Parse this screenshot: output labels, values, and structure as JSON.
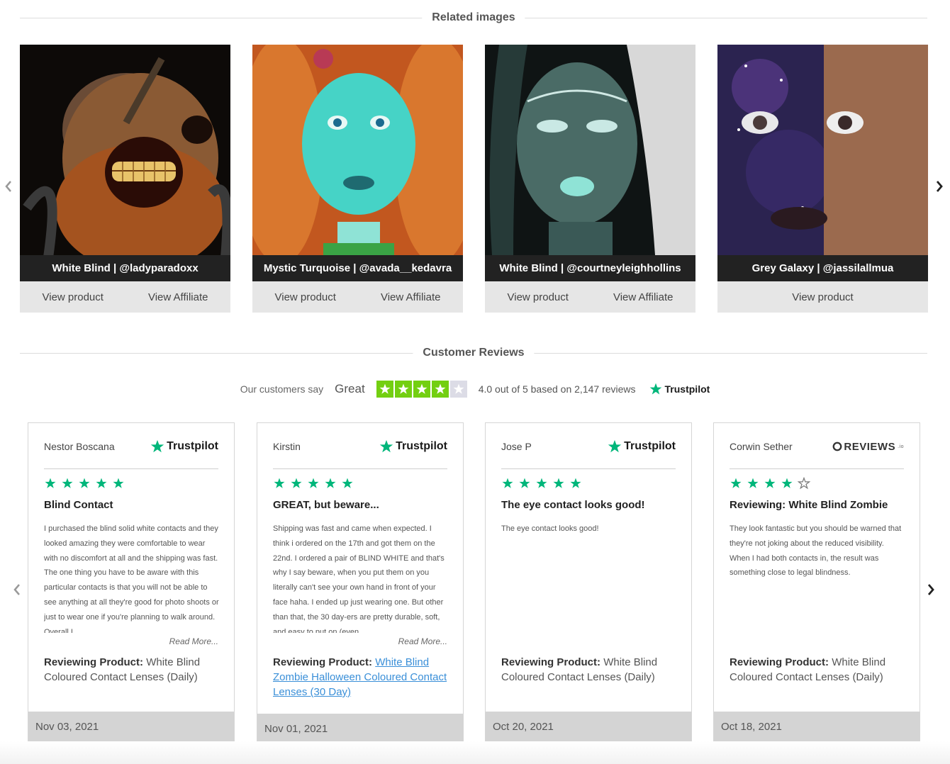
{
  "related": {
    "heading": "Related images",
    "cards": [
      {
        "caption": "White Blind | @ladyparadoxx",
        "view_product": "View product",
        "view_affiliate": "View Affiliate"
      },
      {
        "caption": "Mystic Turquoise | @avada__kedavra",
        "view_product": "View product",
        "view_affiliate": "View Affiliate"
      },
      {
        "caption": "White Blind | @courtneyleighhollins",
        "view_product": "View product",
        "view_affiliate": "View Affiliate"
      },
      {
        "caption": "Grey Galaxy | @jassilallmua",
        "view_product": "View product"
      }
    ]
  },
  "reviews": {
    "heading": "Customer Reviews",
    "summary": {
      "our_customers_say": "Our customers say",
      "rating_word": "Great",
      "stars": 4,
      "stars_max": 5,
      "based_text": "4.0 out of 5 based on 2,147 reviews",
      "brand": "Trustpilot"
    },
    "cards": [
      {
        "name": "Nestor Boscana",
        "source": "Trustpilot",
        "stars": 5,
        "title": "Blind Contact",
        "body": "I purchased the blind solid white contacts and they looked amazing they were comfortable to wear with no discomfort at all and the shipping was fast. The one thing you have to be aware with this particular contacts is that you will not be able to see anything at all they're good for photo shoots or just to wear one if you're planning to walk around. Overall I",
        "read_more": "Read More...",
        "product_label": "Reviewing Product:",
        "product": "White Blind Coloured Contact Lenses (Daily)",
        "date": "Nov 03, 2021"
      },
      {
        "name": "Kirstin",
        "source": "Trustpilot",
        "stars": 5,
        "title": "GREAT, but beware...",
        "body": "Shipping was fast and came when expected. I think i ordered on the 17th and got them on the 22nd. I ordered a pair of BLIND WHITE and that's why I say beware, when you put them on you literally can't see your own hand in front of your face haha. I ended up just wearing one. But other than that, the 30 day-ers are pretty durable, soft, and easy to put on (even",
        "read_more": "Read More...",
        "product_label": "Reviewing Product:",
        "product": "White Blind Zombie Halloween Coloured Contact Lenses (30 Day)",
        "date": "Nov 01, 2021"
      },
      {
        "name": "Jose P",
        "source": "Trustpilot",
        "stars": 5,
        "title": "The eye contact looks good!",
        "body": "The eye contact looks good!",
        "product_label": "Reviewing Product:",
        "product": "White Blind Coloured Contact Lenses (Daily)",
        "date": "Oct 20, 2021"
      },
      {
        "name": "Corwin Sether",
        "source": "REVIEWS",
        "source_suffix": ".io",
        "stars": 4,
        "title": "Reviewing: White Blind Zombie",
        "body": "They look fantastic but you should be warned that they're not joking about the reduced visibility. When I had both contacts in, the result was something close to legal blindness.",
        "product_label": "Reviewing Product:",
        "product": "White Blind Coloured Contact Lenses (Daily)",
        "date": "Oct 18, 2021"
      }
    ]
  },
  "colors": {
    "trustpilot_green": "#00b67a",
    "star_fill": "#73cf11",
    "link": "#3a8fd8"
  },
  "icons": {
    "prev": "chevron-left-icon",
    "next": "chevron-right-icon",
    "star": "star-icon"
  }
}
